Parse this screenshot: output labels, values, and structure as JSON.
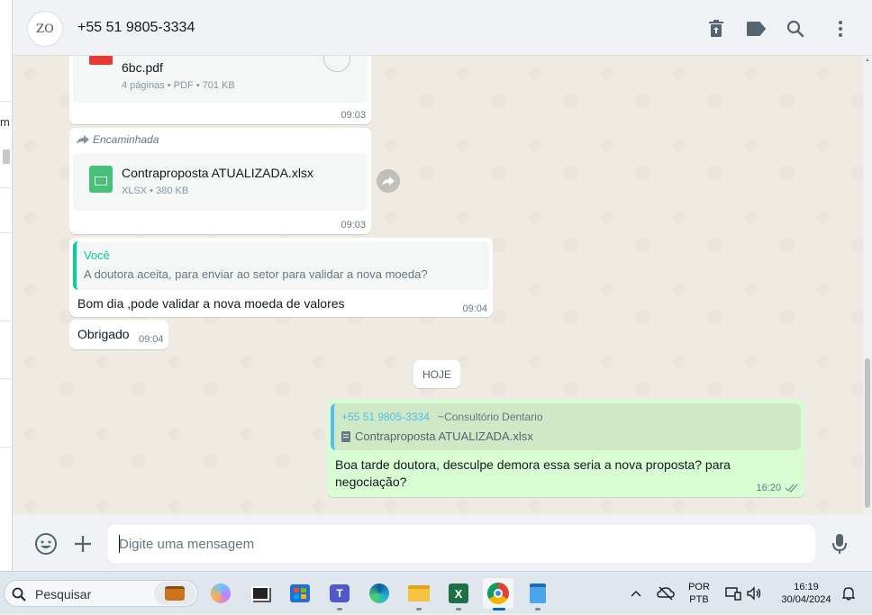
{
  "header": {
    "avatar_text": "ZO",
    "contact": "+55 51 9805-3334",
    "icons": [
      "delete-icon",
      "label-icon",
      "search-icon",
      "menu-icon"
    ]
  },
  "messages": {
    "pdf": {
      "name": "6bc.pdf",
      "meta": "4 páginas • PDF • 701 KB",
      "time": "09:03"
    },
    "xlsx": {
      "forwarded": "Encaminhada",
      "name": "Contraproposta ATUALIZADA.xlsx",
      "meta": "XLSX • 380 KB",
      "time": "09:03"
    },
    "reply": {
      "quote_author": "Você",
      "quote_text": "A doutora aceita, para enviar ao setor para validar a nova moeda?",
      "text": "Bom dia ,pode validar a nova moeda de valores",
      "time": "09:04"
    },
    "thanks": {
      "text": "Obrigado",
      "time": "09:04"
    },
    "date_chip": "HOJE",
    "outgoing": {
      "quote_author": "+55 51 9805-3334",
      "quote_name": "~Consultório Dentario",
      "quote_file": "Contraproposta ATUALIZADA.xlsx",
      "text_line1": "Boa tarde doutora, desculpe demora essa seria a nova proposta? para",
      "text_line2": "negociação?",
      "time": "16:20"
    }
  },
  "compose": {
    "placeholder": "Digite uma mensagem"
  },
  "taskbar": {
    "search_label": "Pesquisar",
    "lang1": "POR",
    "lang2": "PTB",
    "time": "16:19",
    "date": "30/04/2024"
  },
  "left_partial": "m"
}
